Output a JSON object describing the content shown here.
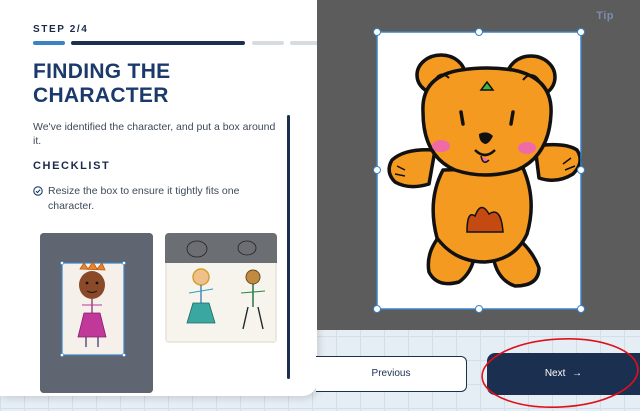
{
  "step": {
    "label": "STEP 2/4",
    "current": 2,
    "total": 4
  },
  "page": {
    "title": "FINDING THE CHARACTER",
    "description": "We've identified the character, and put a box around it."
  },
  "checklist": {
    "heading": "CHECKLIST",
    "items": [
      {
        "text": "Resize the box to ensure it tightly fits one character.",
        "checked": true,
        "icon": "check-circle-icon"
      }
    ]
  },
  "canvas": {
    "tip_label": "Tip"
  },
  "buttons": {
    "previous_label": "Previous",
    "next_label": "Next",
    "next_icon": "→"
  },
  "colors": {
    "navy": "#1b3050",
    "accent_blue": "#3b82c4",
    "canvas_bg": "#5c5c5c",
    "bear_fill": "#f49a20",
    "annotation_red": "#e0101a"
  }
}
